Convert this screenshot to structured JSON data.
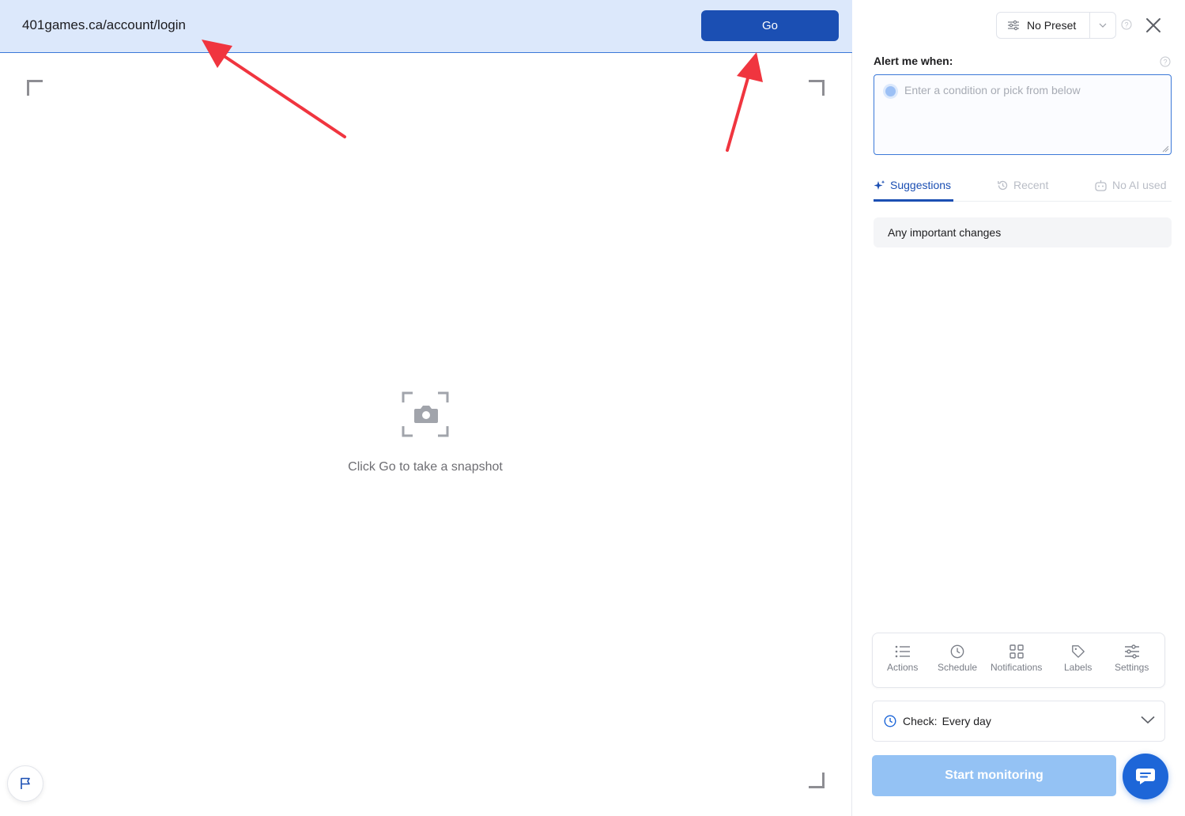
{
  "url_bar": {
    "url": "401games.ca/account/login",
    "go_label": "Go"
  },
  "preview": {
    "empty_text": "Click Go to take a snapshot",
    "camera_icon": "camera-icon",
    "flag_icon": "flag-icon"
  },
  "panel": {
    "preset_label": "No Preset",
    "alert_label": "Alert me when:",
    "condition_placeholder": "Enter a condition or pick from below",
    "tabs": [
      {
        "label": "Suggestions",
        "icon": "sparkle-icon",
        "active": true
      },
      {
        "label": "Recent",
        "icon": "history-icon",
        "active": false
      },
      {
        "label": "No AI used",
        "icon": "robot-icon",
        "active": false
      }
    ],
    "suggestions": [
      "Any important changes"
    ],
    "tools": [
      {
        "label": "Actions",
        "icon": "list-icon"
      },
      {
        "label": "Schedule",
        "icon": "clock-icon"
      },
      {
        "label": "Notifications",
        "icon": "grid-icon"
      },
      {
        "label": "Labels",
        "icon": "tag-icon"
      },
      {
        "label": "Settings",
        "icon": "sliders-icon"
      }
    ],
    "check_label": "Check:",
    "check_value": "Every day",
    "start_label": "Start monitoring"
  },
  "colors": {
    "accent": "#1b4fb3",
    "url_bar_bg": "#dce8fb",
    "start_disabled": "#94c2f4",
    "annotation_arrow": "#f0353f"
  }
}
